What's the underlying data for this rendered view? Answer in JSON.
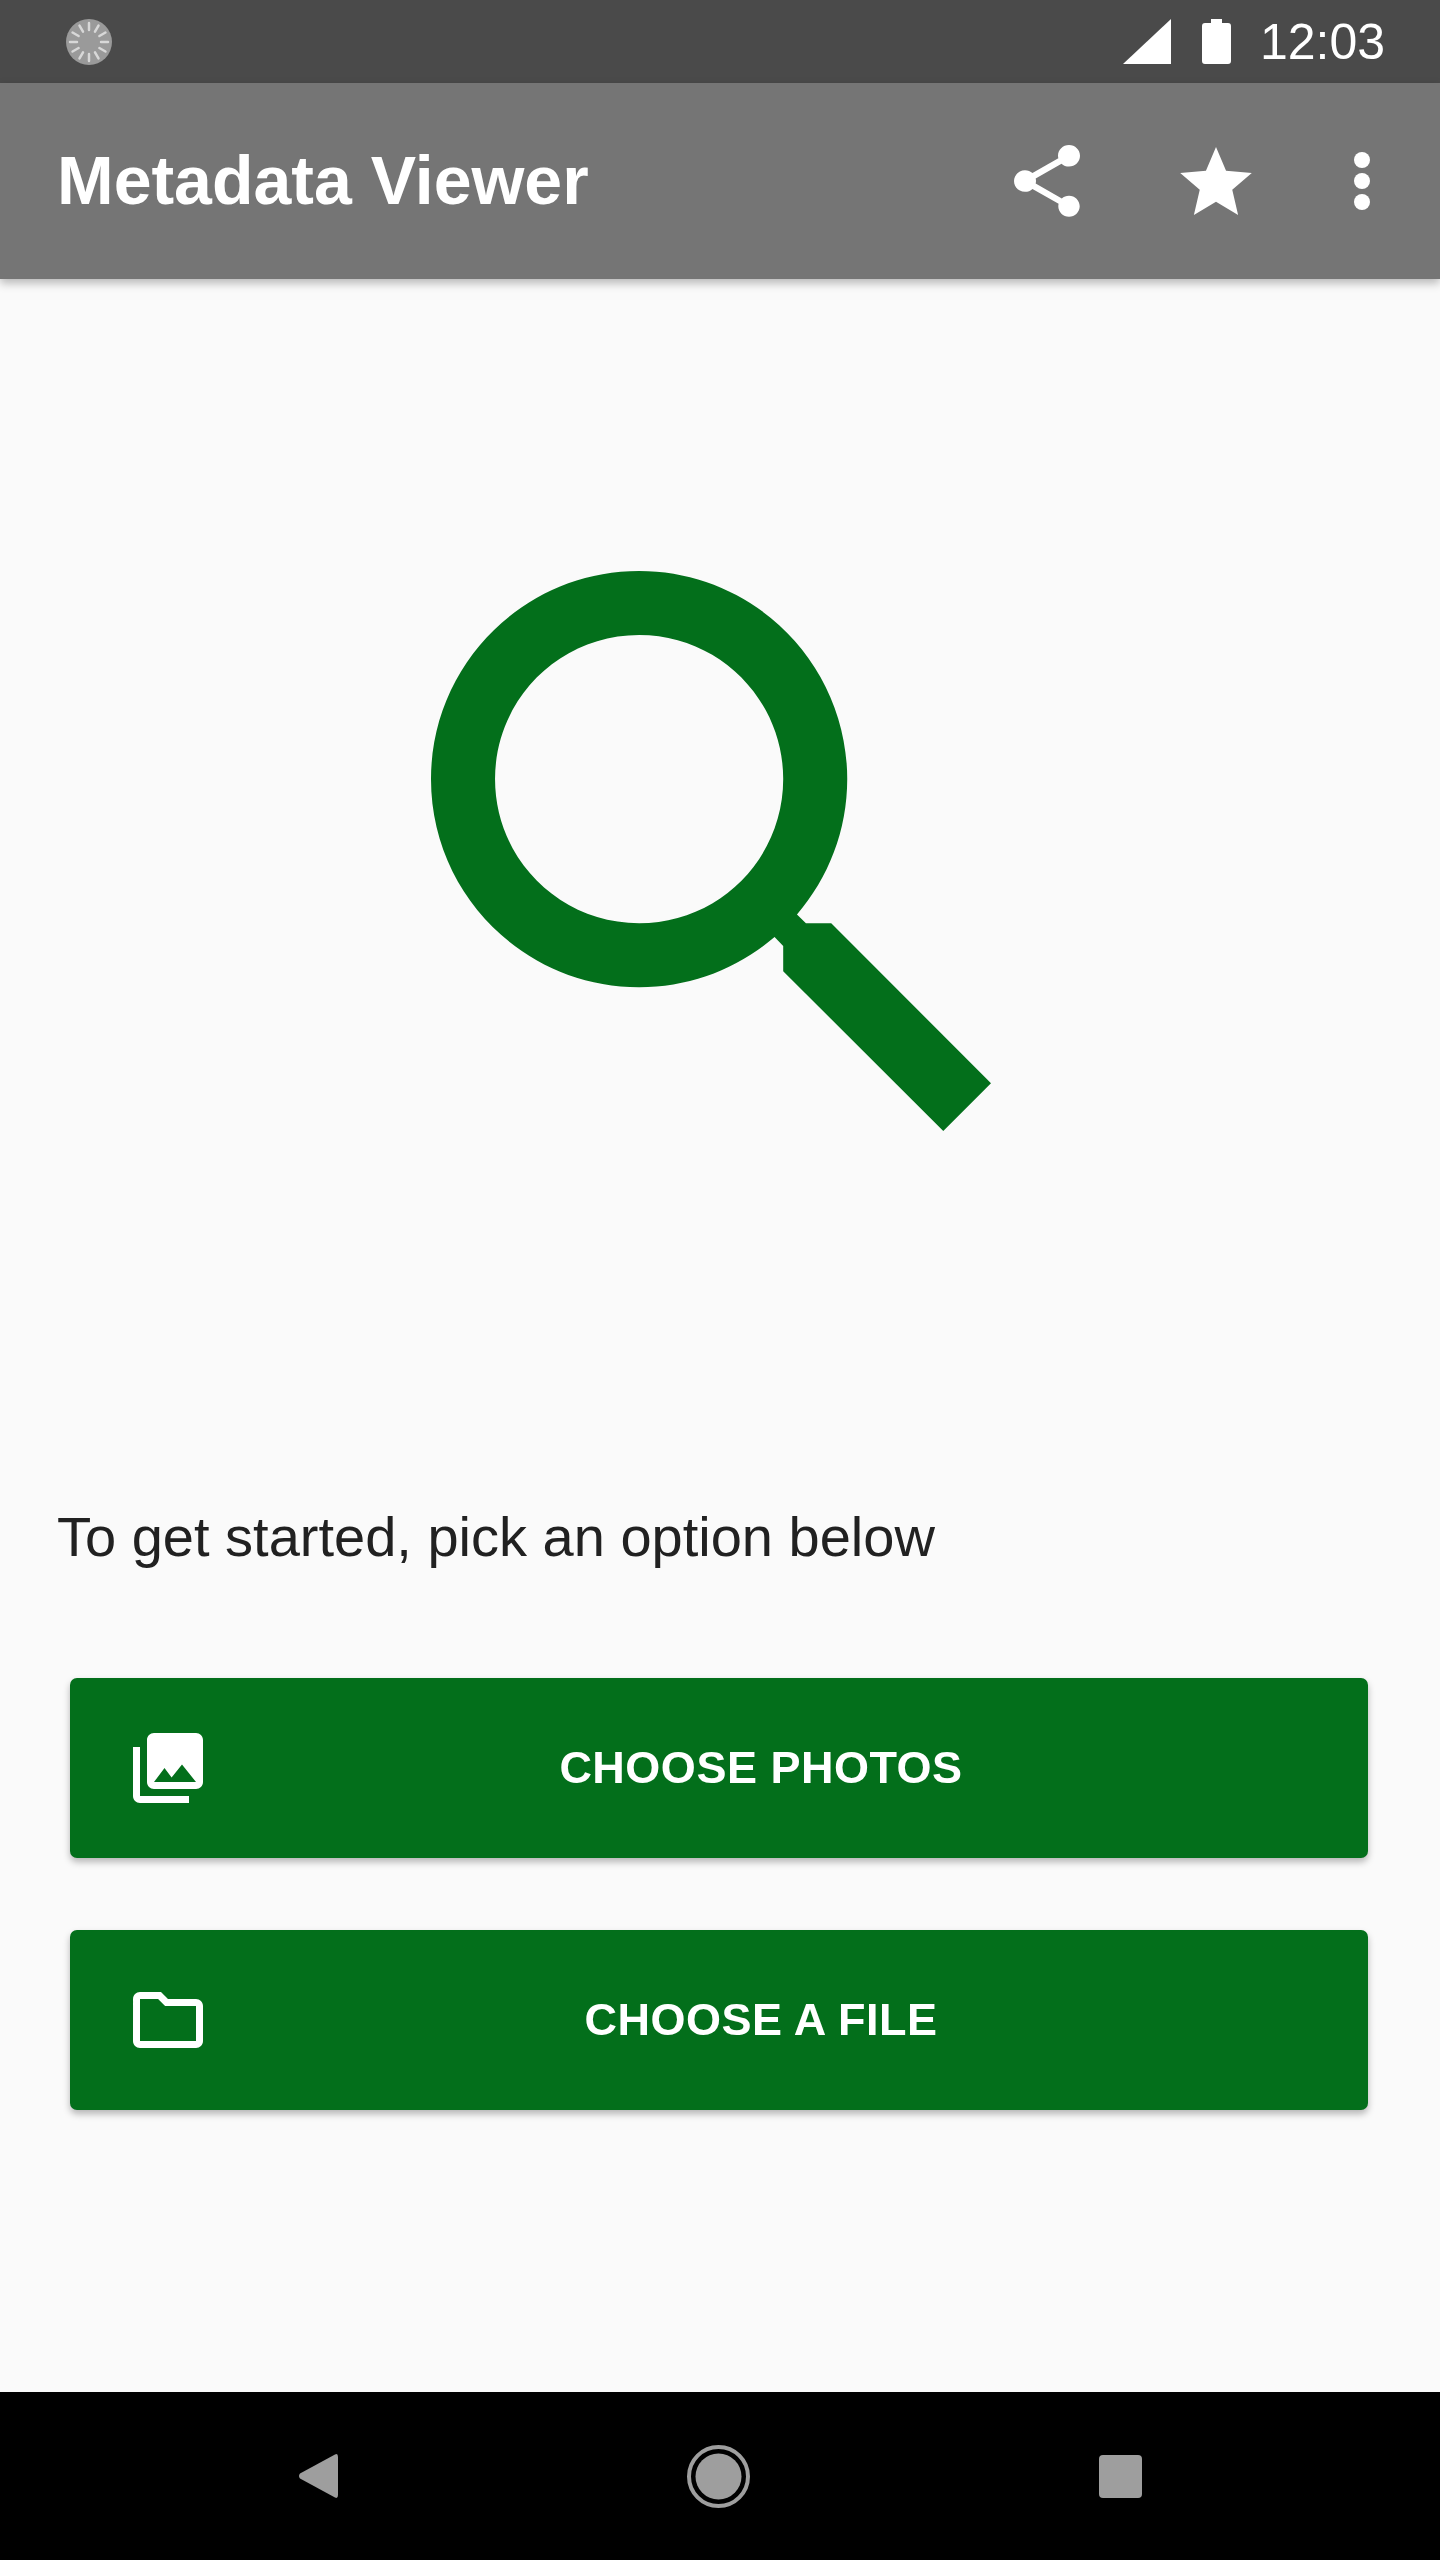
{
  "status_bar": {
    "time": "12:03"
  },
  "app_bar": {
    "title": "Metadata Viewer"
  },
  "prompt": "To get started, pick an option below",
  "buttons": [
    {
      "kind": "photos",
      "label": "CHOOSE PHOTOS"
    },
    {
      "kind": "file",
      "label": "CHOOSE A FILE"
    }
  ]
}
